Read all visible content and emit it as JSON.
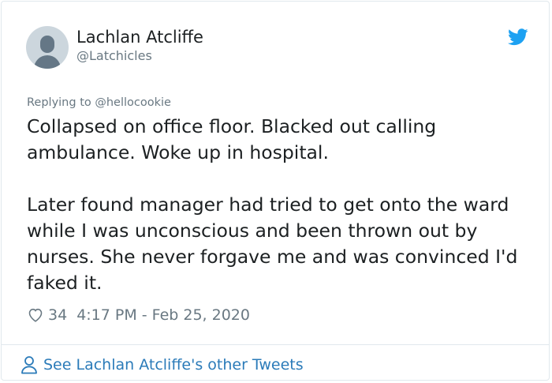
{
  "author": {
    "name": "Lachlan Atcliffe",
    "handle": "@Latchicles"
  },
  "reply": {
    "prefix": "Replying to ",
    "mention": "@hellocookie"
  },
  "tweet": {
    "text": "Collapsed on office floor. Blacked out calling\nambulance. Woke up in hospital.\n\nLater found manager had tried to get onto the ward\nwhile I was unconscious and been thrown out by\nnurses. She never forgave me and was convinced I'd\nfaked it."
  },
  "meta": {
    "likes": "34",
    "timestamp": "4:17 PM - Feb 25, 2020"
  },
  "footer": {
    "link_label": "See Lachlan Atcliffe's other Tweets"
  },
  "icons": {
    "brand": "twitter-bird-icon",
    "like": "heart-icon",
    "profile": "person-icon"
  },
  "colors": {
    "twitter_blue": "#1da1f2",
    "link_blue": "#2b7bb9",
    "secondary_text": "#697882",
    "primary_text": "#1c2022"
  }
}
